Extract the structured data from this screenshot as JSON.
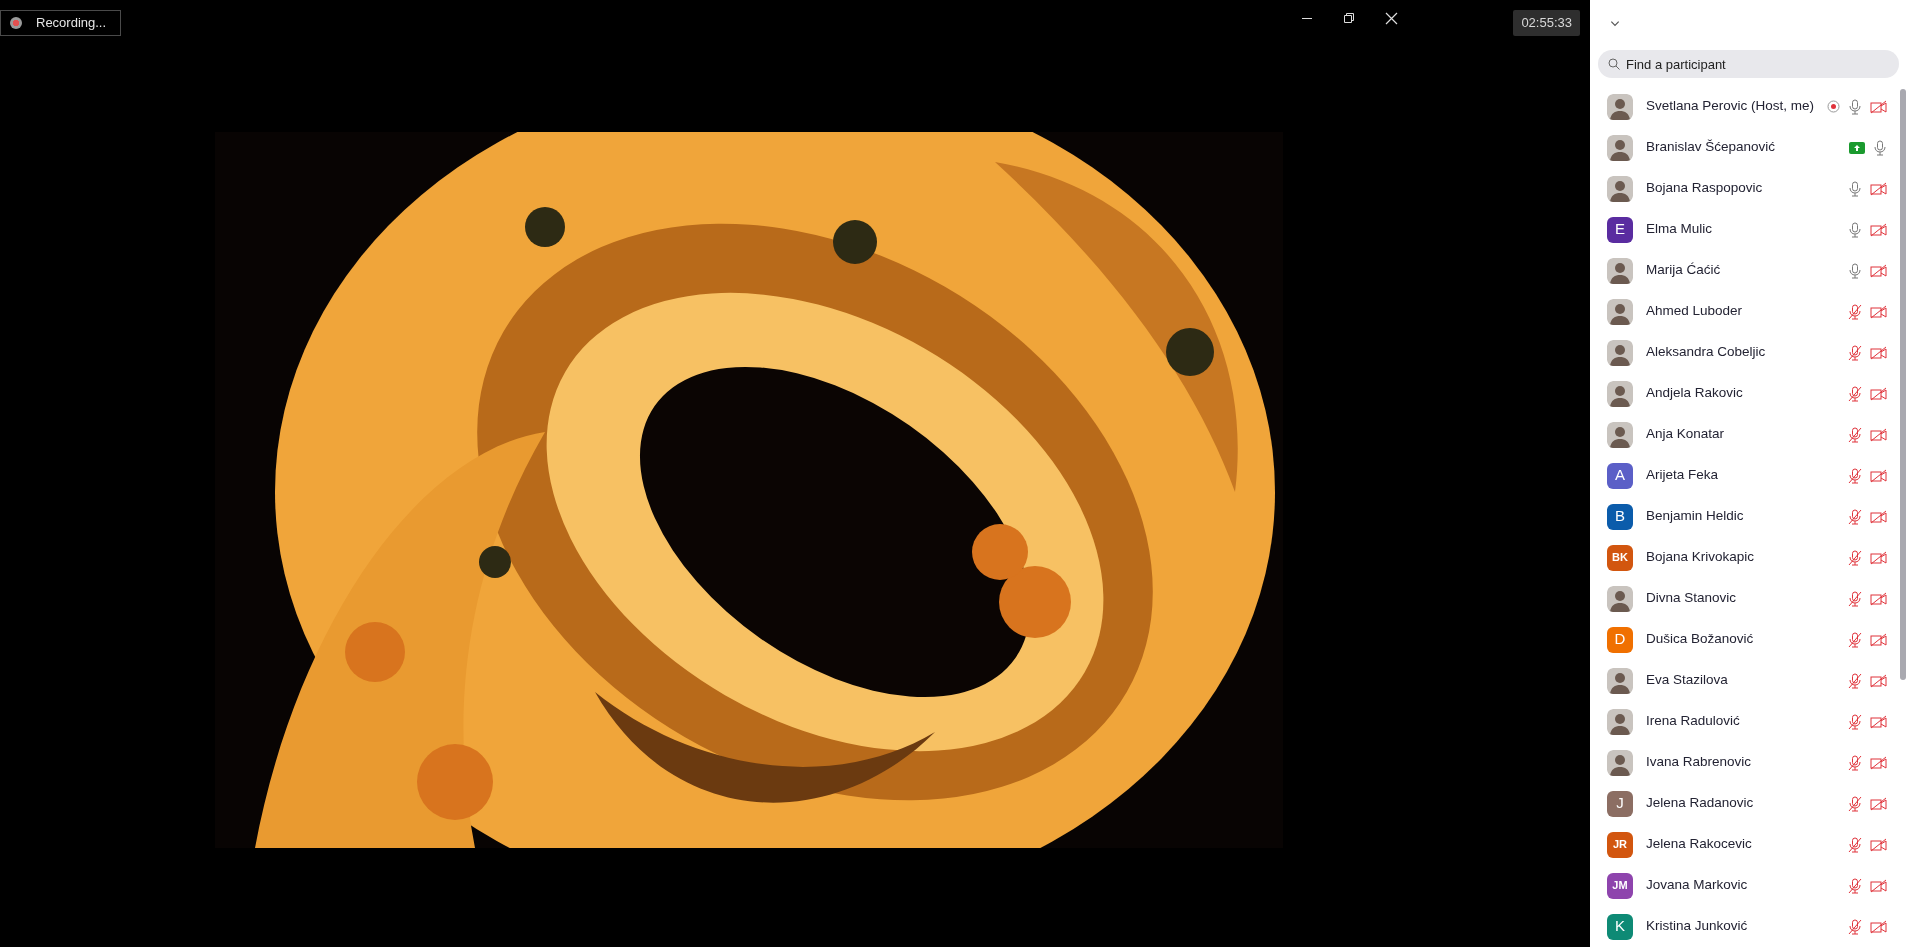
{
  "recording_badge": {
    "label": "Recording..."
  },
  "timer": "02:55:33",
  "search": {
    "placeholder": "Find a participant"
  },
  "participants": [
    {
      "name": "Svetlana Perovic (Host, me)",
      "recording": true,
      "sharing": false,
      "muted": false,
      "video_off": true
    },
    {
      "name": "Branislav Šćepanović",
      "recording": false,
      "sharing": true,
      "muted": false,
      "video_off": false
    },
    {
      "name": "Bojana Raspopovic",
      "muted": false,
      "video_off": true
    },
    {
      "name": "Elma Mulic",
      "avatar": {
        "kind": "initials",
        "text": "E",
        "color": "#5a2ca0"
      },
      "muted": false,
      "video_off": true
    },
    {
      "name": "Marija Ćaćić",
      "muted": false,
      "video_off": true
    },
    {
      "name": "Ahmed Luboder",
      "muted": true,
      "video_off": true
    },
    {
      "name": "Aleksandra Cobeljic",
      "muted": true,
      "video_off": true
    },
    {
      "name": "Andjela Rakovic",
      "muted": true,
      "video_off": true
    },
    {
      "name": "Anja Konatar",
      "muted": true,
      "video_off": true
    },
    {
      "name": "Arijeta Feka",
      "avatar": {
        "kind": "initials",
        "text": "A",
        "color": "#5b5fc7"
      },
      "muted": true,
      "video_off": true
    },
    {
      "name": "Benjamin Heldic",
      "avatar": {
        "kind": "initials",
        "text": "B",
        "color": "#0b5cab"
      },
      "muted": true,
      "video_off": true
    },
    {
      "name": "Bojana Krivokapic",
      "avatar": {
        "kind": "initials",
        "text": "BK",
        "color": "#d2560f"
      },
      "muted": true,
      "video_off": true
    },
    {
      "name": "Divna Stanovic",
      "muted": true,
      "video_off": true
    },
    {
      "name": "Dušica Božanović",
      "avatar": {
        "kind": "initials",
        "text": "D",
        "color": "#f07000"
      },
      "muted": true,
      "video_off": true
    },
    {
      "name": "Eva Stazilova",
      "muted": true,
      "video_off": true
    },
    {
      "name": "Irena Radulović",
      "muted": true,
      "video_off": true
    },
    {
      "name": "Ivana Rabrenovic",
      "muted": true,
      "video_off": true
    },
    {
      "name": "Jelena Radanovic",
      "avatar": {
        "kind": "initials",
        "text": "J",
        "color": "#8c6e63"
      },
      "muted": true,
      "video_off": true
    },
    {
      "name": "Jelena Rakocevic",
      "avatar": {
        "kind": "initials",
        "text": "JR",
        "color": "#d2560f"
      },
      "muted": true,
      "video_off": true
    },
    {
      "name": "Jovana Markovic",
      "avatar": {
        "kind": "initials",
        "text": "JM",
        "color": "#8e44ad"
      },
      "muted": true,
      "video_off": true
    },
    {
      "name": "Kristina Junković",
      "avatar": {
        "kind": "initials",
        "text": "K",
        "color": "#0e8a75"
      },
      "muted": true,
      "video_off": true
    }
  ]
}
